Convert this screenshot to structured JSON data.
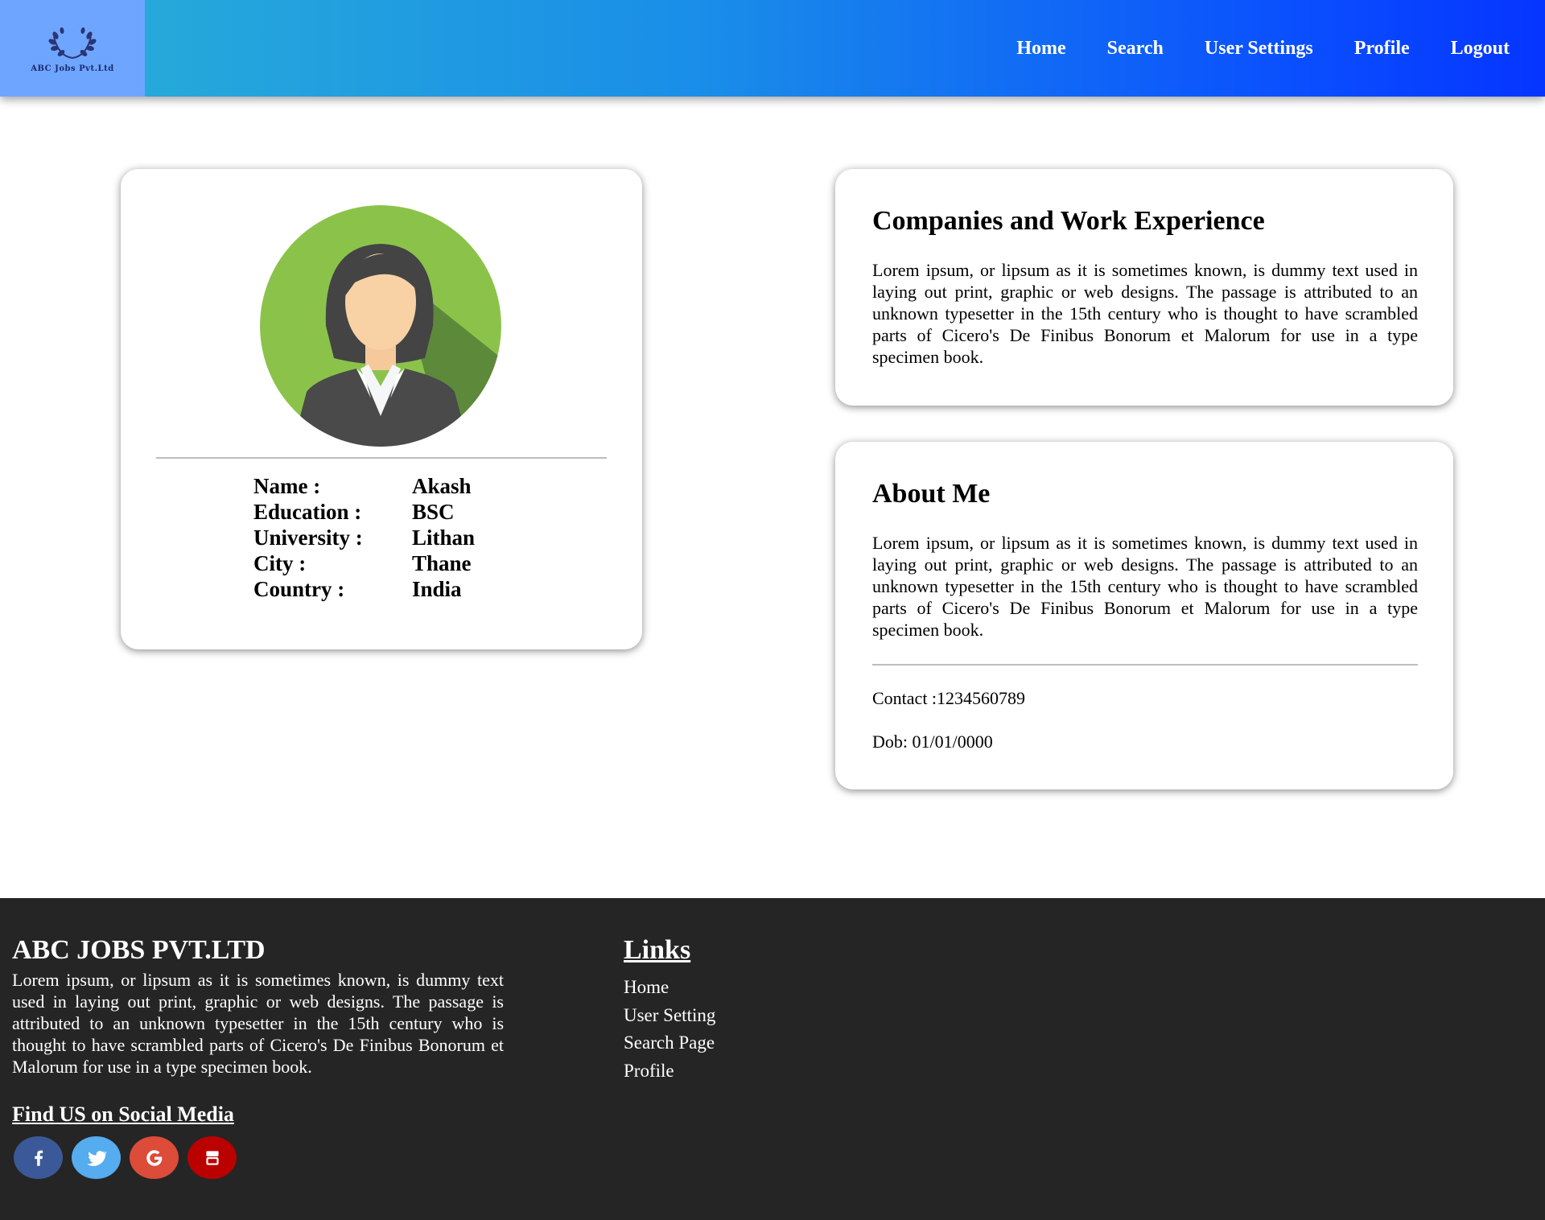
{
  "header": {
    "logo_text": "ABC Jobs Pvt.Ltd",
    "nav": [
      "Home",
      "Search",
      "User Settings",
      "Profile",
      "Logout"
    ]
  },
  "profile": {
    "rows": [
      {
        "label": "Name :",
        "value": "Akash"
      },
      {
        "label": "Education :",
        "value": "BSC"
      },
      {
        "label": "University :",
        "value": "Lithan"
      },
      {
        "label": "City :",
        "value": "Thane"
      },
      {
        "label": "Country :",
        "value": "India"
      }
    ]
  },
  "experience": {
    "title": "Companies and Work Experience",
    "body": "Lorem ipsum, or lipsum as it is sometimes known, is dummy text used in laying out print, graphic or web designs. The passage is attributed to an unknown typesetter in the 15th century who is thought to have scrambled parts of Cicero's De Finibus Bonorum et Malorum for use in a type specimen book."
  },
  "about": {
    "title": "About Me",
    "body": "Lorem ipsum, or lipsum as it is sometimes known, is dummy text used in laying out print, graphic or web designs. The passage is attributed to an unknown typesetter in the 15th century who is thought to have scrambled parts of Cicero's De Finibus Bonorum et Malorum for use in a type specimen book.",
    "contact": "Contact :1234560789",
    "dob": "Dob: 01/01/0000"
  },
  "footer": {
    "brand": "ABC JOBS PVT.LTD",
    "about": "Lorem ipsum, or lipsum as it is sometimes known, is dummy text used in laying out print, graphic or web designs. The passage is attributed to an unknown typesetter in the 15th century who is thought to have scrambled parts of Cicero's De Finibus Bonorum et Malorum for use in a type specimen book.",
    "social_title": "Find US on Social Media",
    "social": [
      {
        "icon": "facebook-icon",
        "color": "#3b5998"
      },
      {
        "icon": "twitter-icon",
        "color": "#55acee"
      },
      {
        "icon": "google-icon",
        "color": "#dd4b39"
      },
      {
        "icon": "youtube-icon",
        "color": "#bb0000"
      }
    ],
    "links_title": "Links",
    "links": [
      "Home",
      "User Setting",
      "Search Page",
      "Profile"
    ]
  },
  "colors": {
    "header_gradient_start": "#29b0d6",
    "header_gradient_end": "#0535ff",
    "logo_bg": "#6ea6ff",
    "footer_bg": "#252525",
    "avatar_bg": "#8bc34a"
  }
}
